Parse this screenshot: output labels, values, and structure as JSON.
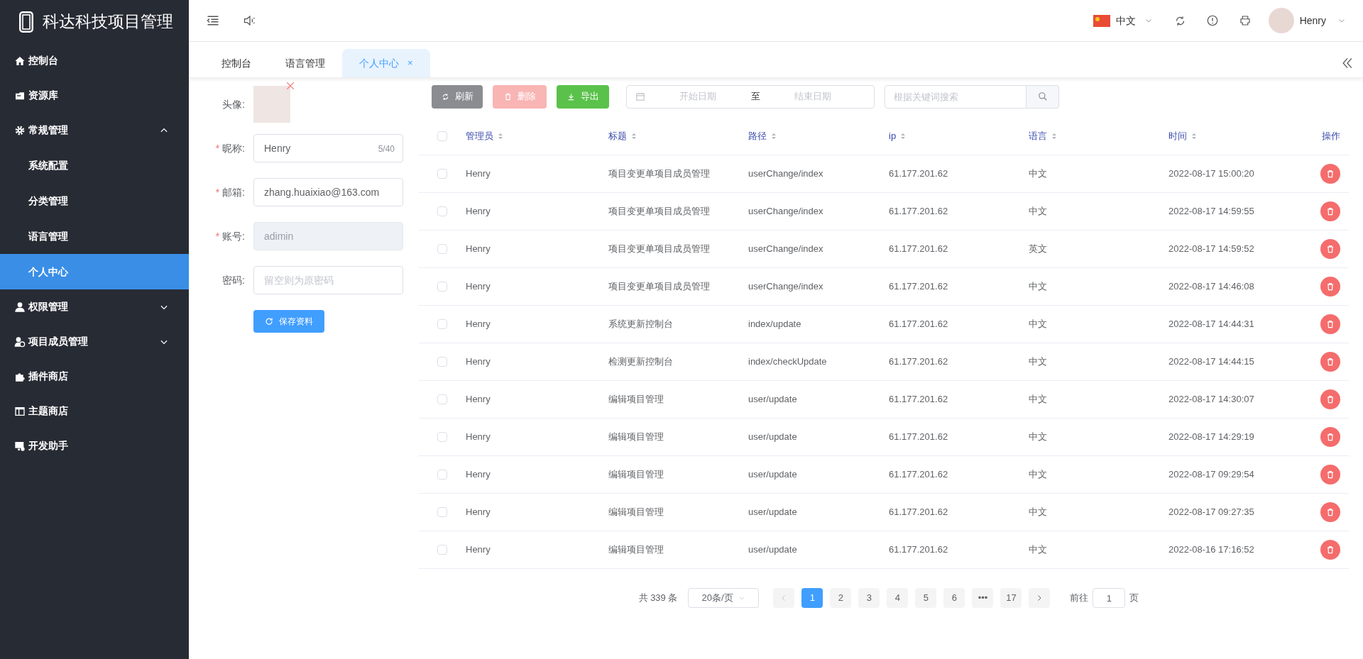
{
  "brand": {
    "title": "科达科技项目管理"
  },
  "sidebar": {
    "items": [
      {
        "label": "控制台",
        "selected": false
      },
      {
        "label": "资源库",
        "selected": false
      },
      {
        "label": "常规管理",
        "selected": false,
        "expanded": true,
        "children": [
          {
            "label": "系统配置",
            "selected": false
          },
          {
            "label": "分类管理",
            "selected": false
          },
          {
            "label": "语言管理",
            "selected": false
          },
          {
            "label": "个人中心",
            "selected": true
          }
        ]
      },
      {
        "label": "权限管理",
        "selected": false,
        "expanded": false
      },
      {
        "label": "项目成员管理",
        "selected": false,
        "expanded": false
      },
      {
        "label": "插件商店",
        "selected": false
      },
      {
        "label": "主题商店",
        "selected": false
      },
      {
        "label": "开发助手",
        "selected": false
      }
    ]
  },
  "header": {
    "language": "中文",
    "user": "Henry"
  },
  "tabs": [
    {
      "label": "控制台",
      "selected": false
    },
    {
      "label": "语言管理",
      "selected": false
    },
    {
      "label": "个人中心",
      "selected": true,
      "close": "×"
    }
  ],
  "profile_form": {
    "fields": [
      {
        "kind": "avatar",
        "label": "头像:"
      },
      {
        "kind": "text",
        "label": "昵称:",
        "required_mark": "*",
        "value": "Henry",
        "counter": "5/40",
        "disabled": false
      },
      {
        "kind": "text",
        "label": "邮箱:",
        "required_mark": "*",
        "value": "zhang.huaixiao@163.com",
        "disabled": false
      },
      {
        "kind": "text",
        "label": "账号:",
        "required_mark": "*",
        "value": "adimin",
        "disabled": true
      },
      {
        "kind": "text",
        "label": "密码:",
        "placeholder": "留空则为原密码",
        "disabled": false
      }
    ],
    "save_button": "保存资料"
  },
  "toolbar": {
    "buttons": [
      {
        "label": "刷新",
        "kind": "refresh",
        "disabled": false
      },
      {
        "label": "删除",
        "kind": "delete",
        "disabled": true
      },
      {
        "label": "导出",
        "kind": "export",
        "disabled": false
      }
    ],
    "date_range": {
      "start_placeholder": "开始日期",
      "separator": "至",
      "end_placeholder": "结束日期"
    },
    "search": {
      "placeholder": "根据关键词搜索"
    }
  },
  "table": {
    "select_all_checked": false,
    "columns": [
      "管理员",
      "标题",
      "路径",
      "ip",
      "语言",
      "时间",
      "操作"
    ],
    "rows": [
      {
        "checked": false,
        "cells": [
          "Henry",
          "项目变更单项目成员管理",
          "userChange/index",
          "61.177.201.62",
          "中文",
          "2022-08-17 15:00:20"
        ]
      },
      {
        "checked": false,
        "cells": [
          "Henry",
          "项目变更单项目成员管理",
          "userChange/index",
          "61.177.201.62",
          "中文",
          "2022-08-17 14:59:55"
        ]
      },
      {
        "checked": false,
        "cells": [
          "Henry",
          "项目变更单项目成员管理",
          "userChange/index",
          "61.177.201.62",
          "英文",
          "2022-08-17 14:59:52"
        ]
      },
      {
        "checked": false,
        "cells": [
          "Henry",
          "项目变更单项目成员管理",
          "userChange/index",
          "61.177.201.62",
          "中文",
          "2022-08-17 14:46:08"
        ]
      },
      {
        "checked": false,
        "cells": [
          "Henry",
          "系统更新控制台",
          "index/update",
          "61.177.201.62",
          "中文",
          "2022-08-17 14:44:31"
        ]
      },
      {
        "checked": false,
        "cells": [
          "Henry",
          "检测更新控制台",
          "index/checkUpdate",
          "61.177.201.62",
          "中文",
          "2022-08-17 14:44:15"
        ]
      },
      {
        "checked": false,
        "cells": [
          "Henry",
          "编辑项目管理",
          "user/update",
          "61.177.201.62",
          "中文",
          "2022-08-17 14:30:07"
        ]
      },
      {
        "checked": false,
        "cells": [
          "Henry",
          "编辑项目管理",
          "user/update",
          "61.177.201.62",
          "中文",
          "2022-08-17 14:29:19"
        ]
      },
      {
        "checked": false,
        "cells": [
          "Henry",
          "编辑项目管理",
          "user/update",
          "61.177.201.62",
          "中文",
          "2022-08-17 09:29:54"
        ]
      },
      {
        "checked": false,
        "cells": [
          "Henry",
          "编辑项目管理",
          "user/update",
          "61.177.201.62",
          "中文",
          "2022-08-17 09:27:35"
        ]
      },
      {
        "checked": false,
        "cells": [
          "Henry",
          "编辑项目管理",
          "user/update",
          "61.177.201.62",
          "中文",
          "2022-08-16 17:16:52"
        ]
      }
    ]
  },
  "pagination": {
    "total": "共 339 条",
    "page_size": "20条/页",
    "pages": [
      {
        "label": "1",
        "selected": true
      },
      {
        "label": "2",
        "selected": false
      },
      {
        "label": "3",
        "selected": false
      },
      {
        "label": "4",
        "selected": false
      },
      {
        "label": "5",
        "selected": false
      },
      {
        "label": "6",
        "selected": false
      },
      {
        "label": "•••",
        "selected": false
      },
      {
        "label": "17",
        "selected": false
      }
    ],
    "goto_label": "前往",
    "goto_value": "1",
    "goto_suffix": "页"
  }
}
